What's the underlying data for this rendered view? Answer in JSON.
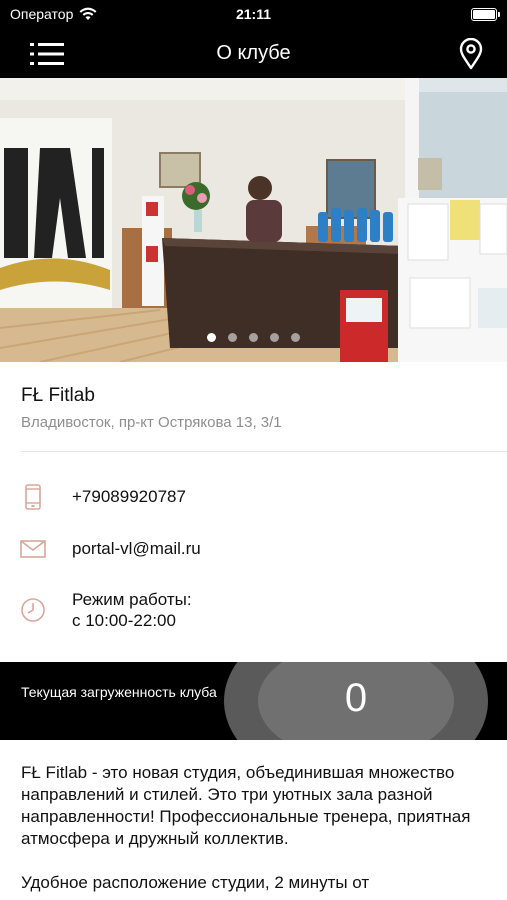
{
  "status_bar": {
    "carrier": "Оператор",
    "time": "21:11"
  },
  "nav": {
    "title": "О клубе",
    "menu_icon": "hamburger-menu-icon",
    "map_icon": "map-pin-icon"
  },
  "gallery": {
    "slides_count": 5,
    "active_slide": 1
  },
  "club": {
    "name": "FŁ Fitlab",
    "address": "Владивосток, пр-кт Острякова 13, 3/1"
  },
  "contacts": {
    "phone": "+79089920787",
    "email": "portal-vl@mail.ru",
    "hours_label": "Режим работы:",
    "hours_value": "с 10:00-22:00"
  },
  "load": {
    "label": "Текущая загруженность клуба",
    "value": "0"
  },
  "description": {
    "paragraph_1": "FŁ Fitlab - это новая студия, объединившая множество направлений и стилей. Это три уютных зала разной направленности! Профессиональные тренера, приятная атмосфера и дружный коллектив.",
    "paragraph_2": "Удобное расположение студии, 2 минуты от"
  },
  "colors": {
    "accent_icon": "#d9a79a",
    "header_bg": "#000000"
  }
}
